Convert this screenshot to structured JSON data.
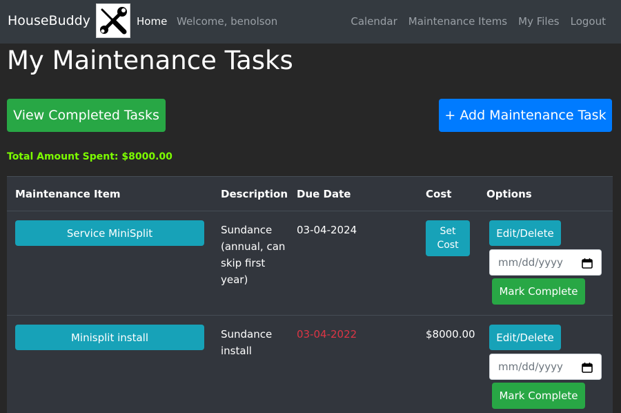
{
  "nav": {
    "brand": "HouseBuddy",
    "home": "Home",
    "welcome": "Welcome, benolson",
    "links": [
      "Calendar",
      "Maintenance Items",
      "My Files",
      "Logout"
    ],
    "logo_icon": "tools-icon"
  },
  "page": {
    "title": "My Maintenance Tasks",
    "view_completed_label": "View Completed Tasks",
    "add_task_label": "+ Add Maintenance Task",
    "total_spent": "Total Amount Spent: $8000.00"
  },
  "table": {
    "headers": [
      "Maintenance Item",
      "Description",
      "Due Date",
      "Cost",
      "Options"
    ],
    "rows": [
      {
        "item": "Service MiniSplit",
        "description": "Sundance (annual, can skip first year)",
        "due_date": "03-04-2024",
        "overdue": false,
        "cost": "",
        "set_cost_line1": "Set",
        "set_cost_line2": "Cost",
        "edit_label": "Edit/Delete",
        "date_placeholder": "mm/dd/yyyy",
        "complete_label": "Mark Complete"
      },
      {
        "item": "Minisplit install",
        "description": "Sundance install",
        "due_date": "03-04-2022",
        "overdue": true,
        "cost": "$8000.00",
        "edit_label": "Edit/Delete",
        "date_placeholder": "mm/dd/yyyy",
        "complete_label": "Mark Complete"
      }
    ]
  },
  "colors": {
    "navbar": "#343a40",
    "background": "#272727",
    "success": "#28a745",
    "primary": "#007bff",
    "info": "#17a2b8",
    "danger": "#dc3545",
    "total_text": "#7cfc00"
  }
}
